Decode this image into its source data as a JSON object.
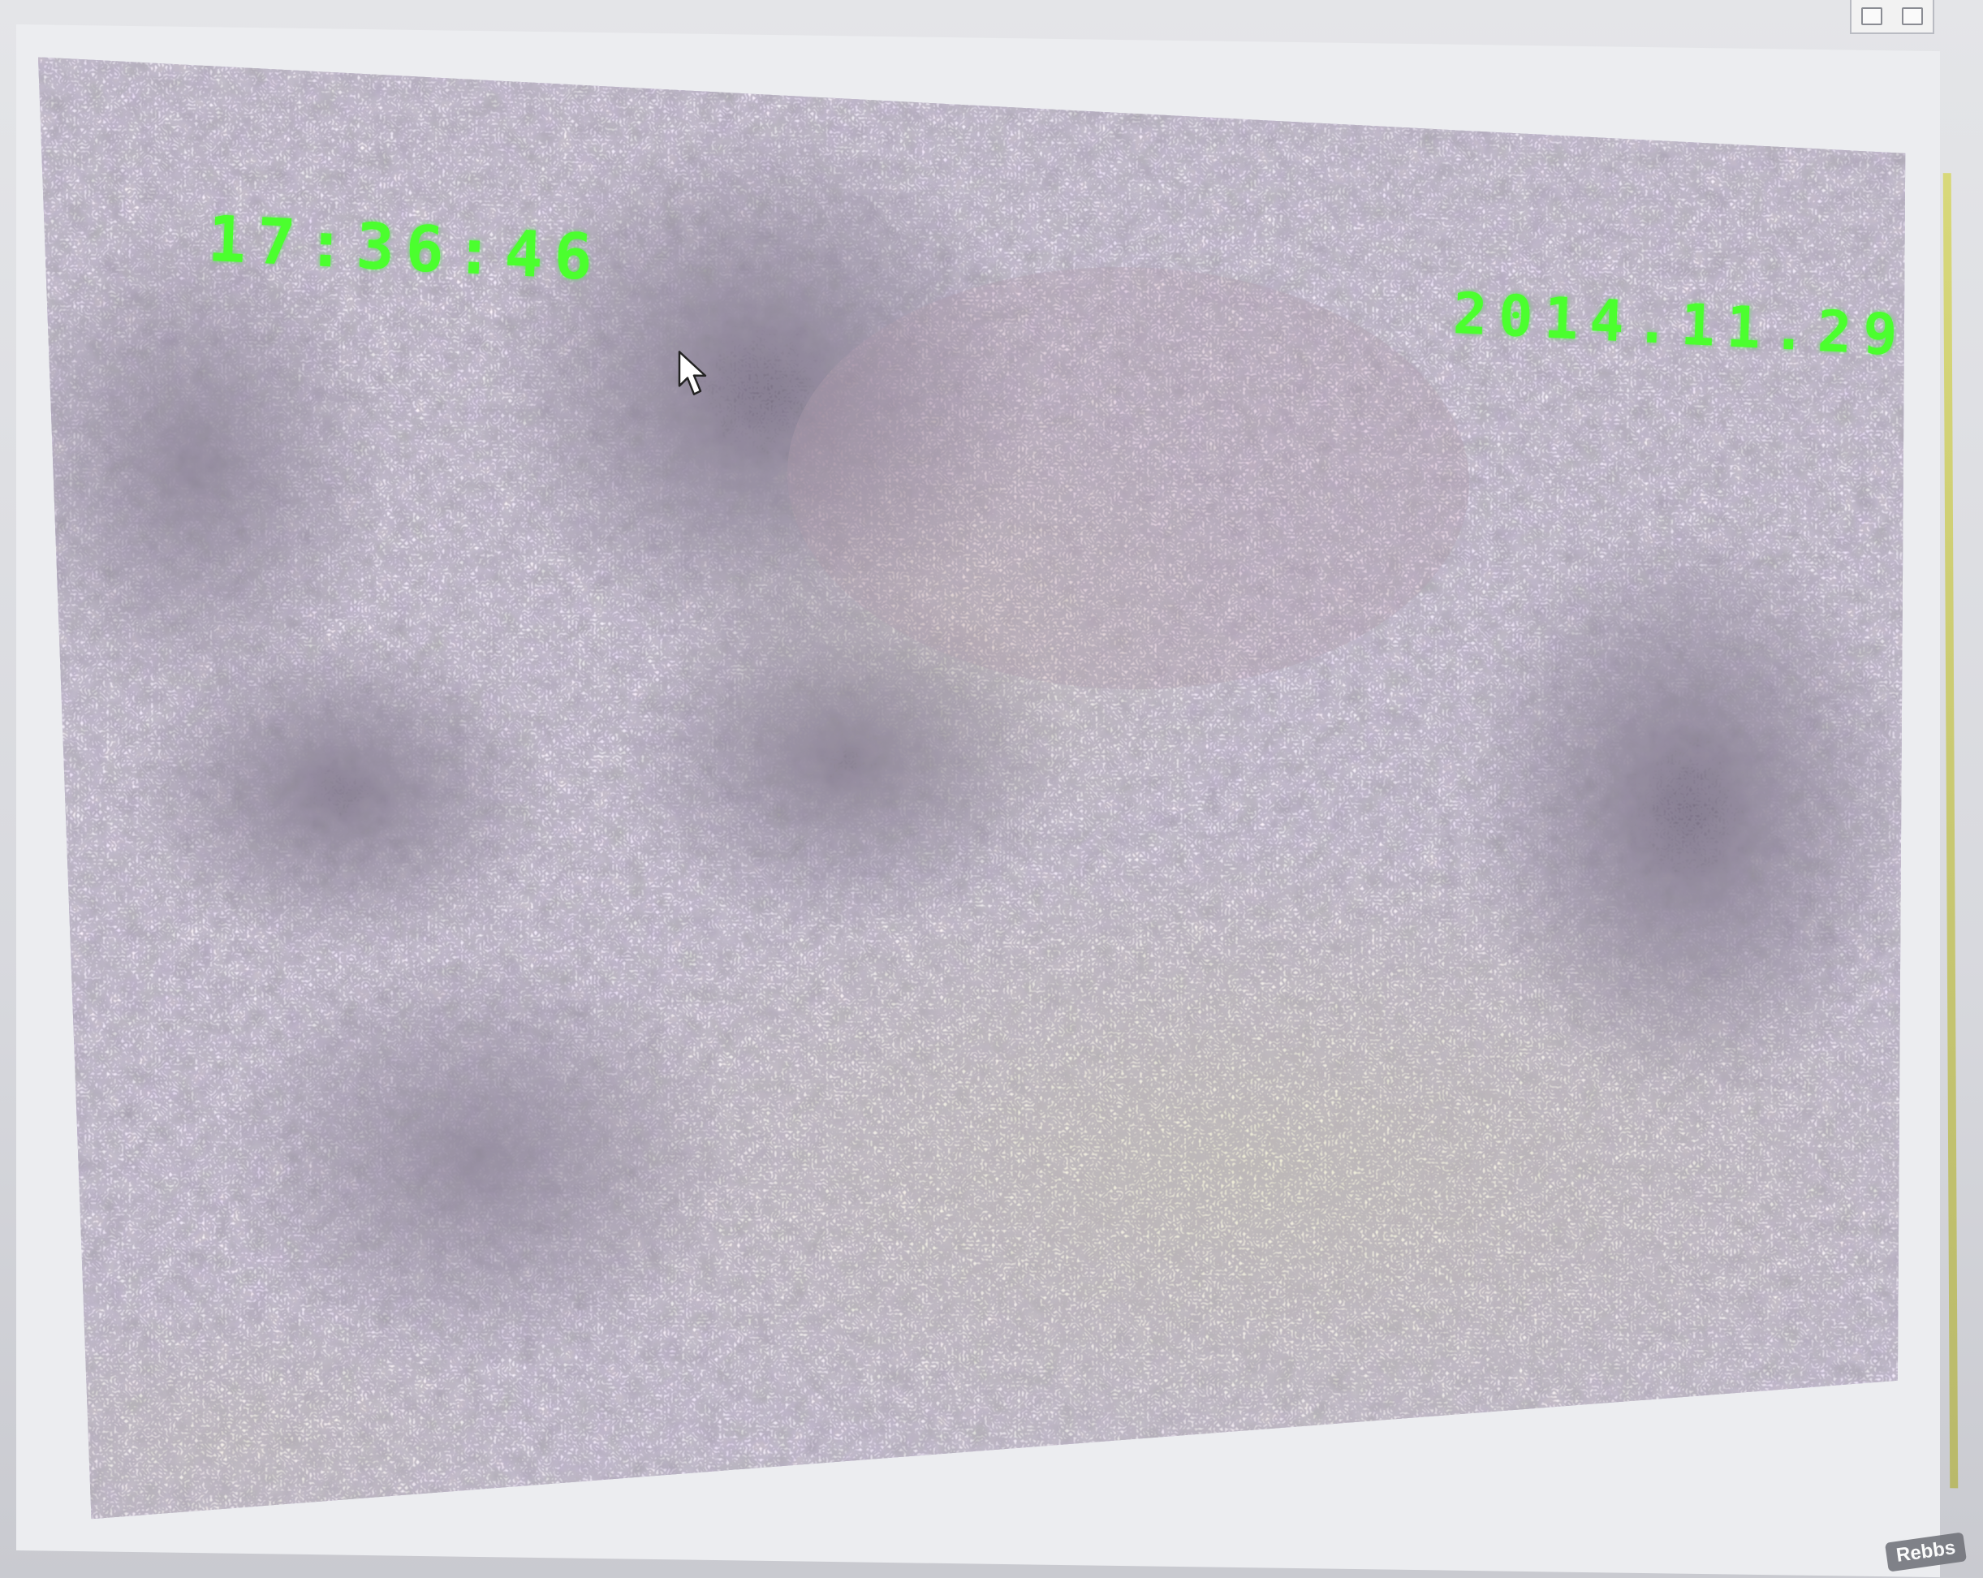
{
  "video": {
    "time_overlay": "17:36:46",
    "date_overlay": "2014.11.29",
    "overlay_color": "#4bff2e"
  },
  "watermark": {
    "text": "Rebbs"
  },
  "palette": {
    "dark_purple": "#6b5a7d",
    "mid_lavender": "#9c93b5",
    "pale_yellow": "#e9eac7",
    "grey_green": "#7c8a7a"
  },
  "icons": [
    "mouse-pointer-icon"
  ]
}
